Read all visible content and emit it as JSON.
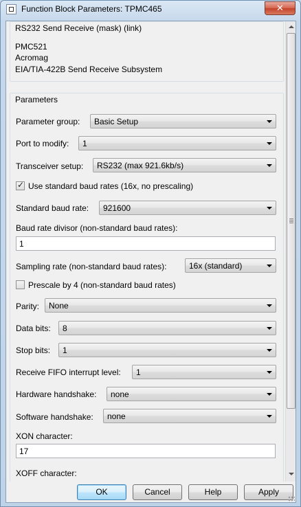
{
  "window": {
    "title": "Function Block Parameters: TPMC465",
    "close_label": "✕"
  },
  "description": {
    "title": "RS232 Send Receive (mask) (link)",
    "lines": [
      "PMC521",
      "Acromag",
      "EIA/TIA-422B Send Receive Subsystem"
    ]
  },
  "parameters": {
    "title": "Parameters",
    "parameter_group": {
      "label": "Parameter group:",
      "value": "Basic Setup"
    },
    "port_to_modify": {
      "label": "Port to modify:",
      "value": "1"
    },
    "transceiver_setup": {
      "label": "Transceiver setup:",
      "value": "RS232 (max 921.6kb/s)"
    },
    "use_standard_baud": {
      "label": "Use standard baud rates (16x, no prescaling)",
      "checked": true
    },
    "standard_baud_rate": {
      "label": "Standard baud rate:",
      "value": "921600"
    },
    "baud_rate_divisor": {
      "label": "Baud rate divisor (non-standard baud rates):",
      "value": "1"
    },
    "sampling_rate": {
      "label": "Sampling rate (non-standard baud rates):",
      "value": "16x (standard)"
    },
    "prescale": {
      "label": "Prescale by 4 (non-standard baud rates)",
      "checked": false
    },
    "parity": {
      "label": "Parity:",
      "value": "None"
    },
    "data_bits": {
      "label": "Data bits:",
      "value": "8"
    },
    "stop_bits": {
      "label": "Stop bits:",
      "value": "1"
    },
    "fifo_level": {
      "label": "Receive FIFO interrupt level:",
      "value": "1"
    },
    "hardware_handshake": {
      "label": "Hardware handshake:",
      "value": "none"
    },
    "software_handshake": {
      "label": "Software handshake:",
      "value": "none"
    },
    "xon": {
      "label": "XON character:",
      "value": "17"
    },
    "xoff": {
      "label": "XOFF character:"
    }
  },
  "buttons": {
    "ok": "OK",
    "cancel": "Cancel",
    "help": "Help",
    "apply": "Apply"
  }
}
